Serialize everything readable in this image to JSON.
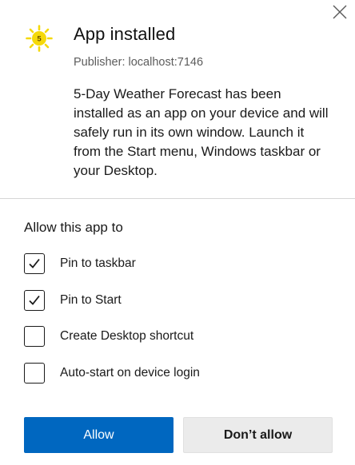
{
  "dialog": {
    "title": "App installed",
    "publisher": "Publisher: localhost:7146",
    "description": "5-Day Weather Forecast has been installed as an app on your device and will safely run in its own window. Launch it from the Start menu, Windows taskbar or your Desktop.",
    "app_icon": {
      "icon": "sun-icon",
      "badge_text": "5",
      "color": "#f5d90a"
    },
    "close_icon": "close-icon"
  },
  "permissions": {
    "title": "Allow this app to",
    "options": [
      {
        "label": "Pin to taskbar",
        "checked": true
      },
      {
        "label": "Pin to Start",
        "checked": true
      },
      {
        "label": "Create Desktop shortcut",
        "checked": false
      },
      {
        "label": "Auto-start on device login",
        "checked": false
      }
    ]
  },
  "buttons": {
    "allow_label": "Allow",
    "deny_label": "Don’t allow"
  },
  "colors": {
    "accent": "#0067c0",
    "secondary_button": "#ebebeb"
  }
}
